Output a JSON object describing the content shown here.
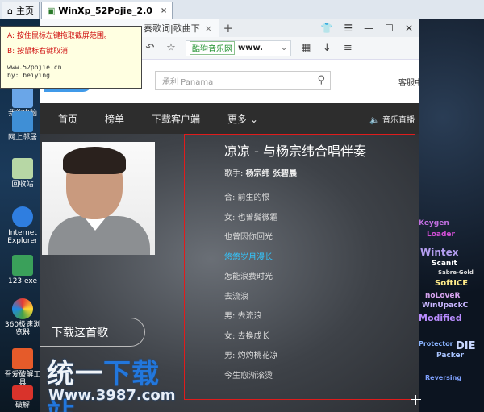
{
  "vm_tabs": [
    {
      "label": "主页",
      "icon": "home-icon"
    },
    {
      "label": "WinXp_52Pojie_2.0",
      "icon": "vm-icon",
      "close": "×"
    }
  ],
  "desktop_icons": [
    {
      "label": "我的电脑"
    },
    {
      "label": "网上邻居"
    },
    {
      "label": "回收站"
    },
    {
      "label": "Internet Explorer"
    },
    {
      "label": "123.exe"
    },
    {
      "label": "360极速浏览器"
    },
    {
      "label": "吾爱破解工具"
    },
    {
      "label": "破解"
    }
  ],
  "browser": {
    "tab_partial": "奏歌词|歌曲下",
    "tab_close": "×",
    "new_tab": "+",
    "site_badge": "酷狗音乐网",
    "url": "www.",
    "search_placeholder": "承利 Panama",
    "customer_link": "客服中",
    "nav": {
      "items": [
        "首页",
        "榜单",
        "下载客户端",
        "更多"
      ],
      "live": "音乐直播"
    }
  },
  "tooltip": {
    "line1": "A: 按住鼠标左键拖取截屏范围。",
    "line2": "B: 按鼠标右键取消",
    "site": "www.52pojie.cn",
    "by": "by: beiying"
  },
  "song": {
    "title": "凉凉 - 与杨宗纬合唱伴奏",
    "singer_label": "歌手:",
    "singer": "杨宗纬 张碧晨",
    "download_label": "下载这首歌",
    "lyrics": [
      {
        "text": "合: 前生的恨",
        "highlight": false
      },
      {
        "text": "女: 也曾鬓微霜",
        "highlight": false
      },
      {
        "text": "也曾因你回光",
        "highlight": false
      },
      {
        "text": "悠悠岁月漫长",
        "highlight": true
      },
      {
        "text": "怎能浪费时光",
        "highlight": false
      },
      {
        "text": "去流浪",
        "highlight": false
      },
      {
        "text": "男: 去流浪",
        "highlight": false
      },
      {
        "text": "女: 去换成长",
        "highlight": false
      },
      {
        "text": "男: 灼灼桃花凉",
        "highlight": false
      },
      {
        "text": "今生愈渐滚烫",
        "highlight": false
      }
    ]
  },
  "watermark": {
    "title_white": "统一",
    "title_blue": "下载站",
    "url": "Www.3987.com"
  },
  "right_art": [
    "Keygen",
    "Loader",
    "Wintex",
    "Scanit",
    "Sabre-Gold",
    "SoftICE",
    "noLoveR",
    "WinUpackC",
    "Modified",
    "Protector",
    "DIE",
    "Packer",
    "Reversing"
  ],
  "colors": {
    "accent_red": "#e01c1c",
    "highlight_lyric": "#33c7ff",
    "nav_bg": "#2d2d2d"
  }
}
